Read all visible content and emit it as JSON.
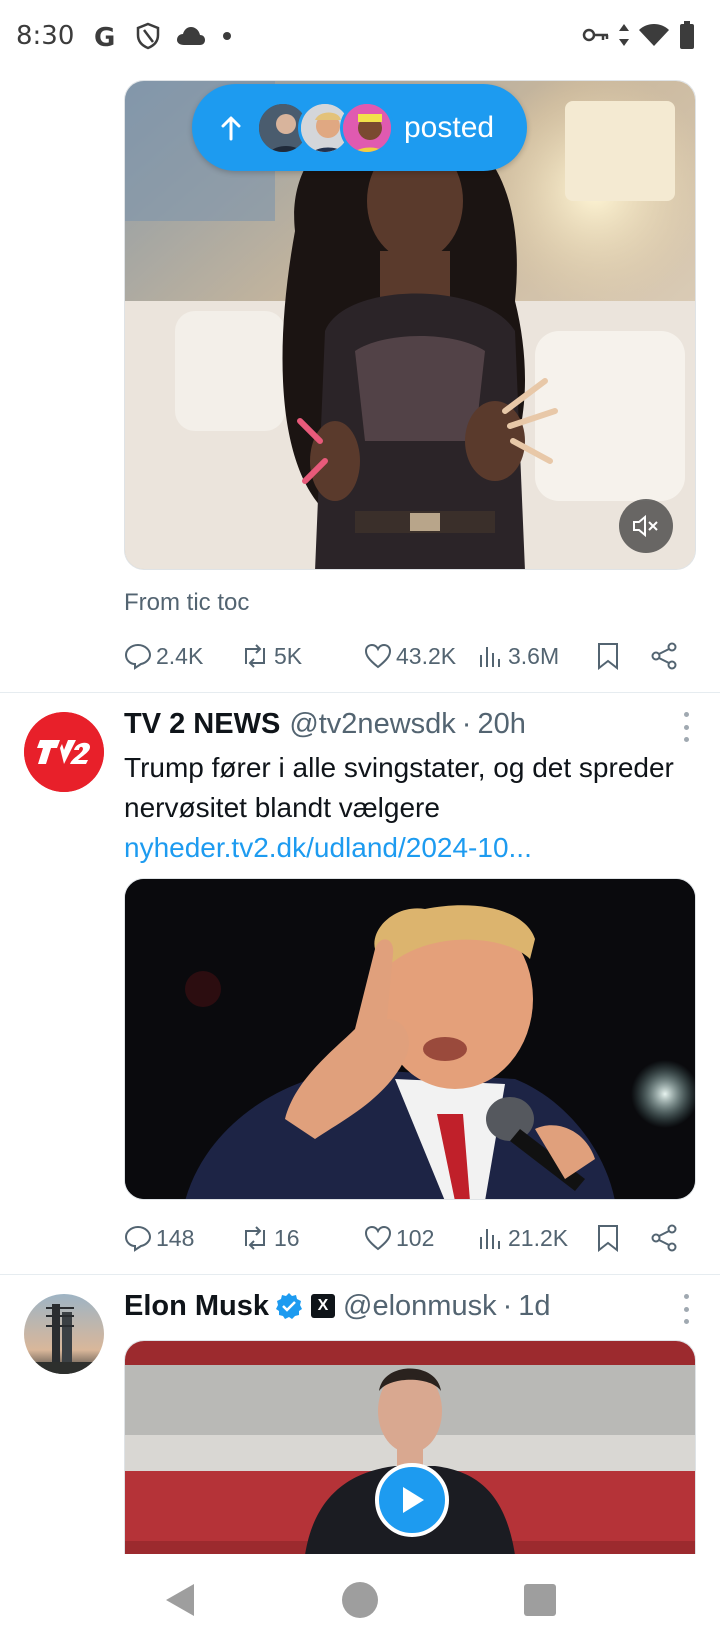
{
  "status_bar": {
    "time": "8:30",
    "left_icons": [
      "google-icon",
      "shield-icon",
      "cloud-icon",
      "dot-icon"
    ],
    "right_icons": [
      "vpn-key-icon",
      "data-arrows-icon",
      "wifi-icon",
      "battery-icon"
    ]
  },
  "posted_pill": {
    "label": "posted",
    "avatar_count": 3
  },
  "tweets": [
    {
      "caption": "From tic toc",
      "media": "video",
      "stats": {
        "replies": "2.4K",
        "reposts": "5K",
        "likes": "43.2K",
        "views": "3.6M"
      }
    },
    {
      "author": "TV 2 NEWS",
      "handle": "@tv2newsdk",
      "separator": "·",
      "time": "20h",
      "avatar_text": "TV2",
      "text": "Trump fører i alle svingstater, og det spreder nervøsitet blandt vælgere",
      "link": "nyheder.tv2.dk/udland/2024-10...",
      "media": "photo",
      "stats": {
        "replies": "148",
        "reposts": "16",
        "likes": "102",
        "views": "21.2K"
      }
    },
    {
      "author": "Elon Musk",
      "handle": "@elonmusk",
      "separator": "·",
      "time": "1d",
      "verified": true,
      "affiliate_badge": "X",
      "media": "video"
    }
  ],
  "colors": {
    "accent": "#1d9bf0",
    "secondary_text": "#536471",
    "tv2_red": "#e8202a"
  },
  "nav": {
    "buttons": [
      "back-icon",
      "home-icon",
      "recents-icon"
    ]
  }
}
